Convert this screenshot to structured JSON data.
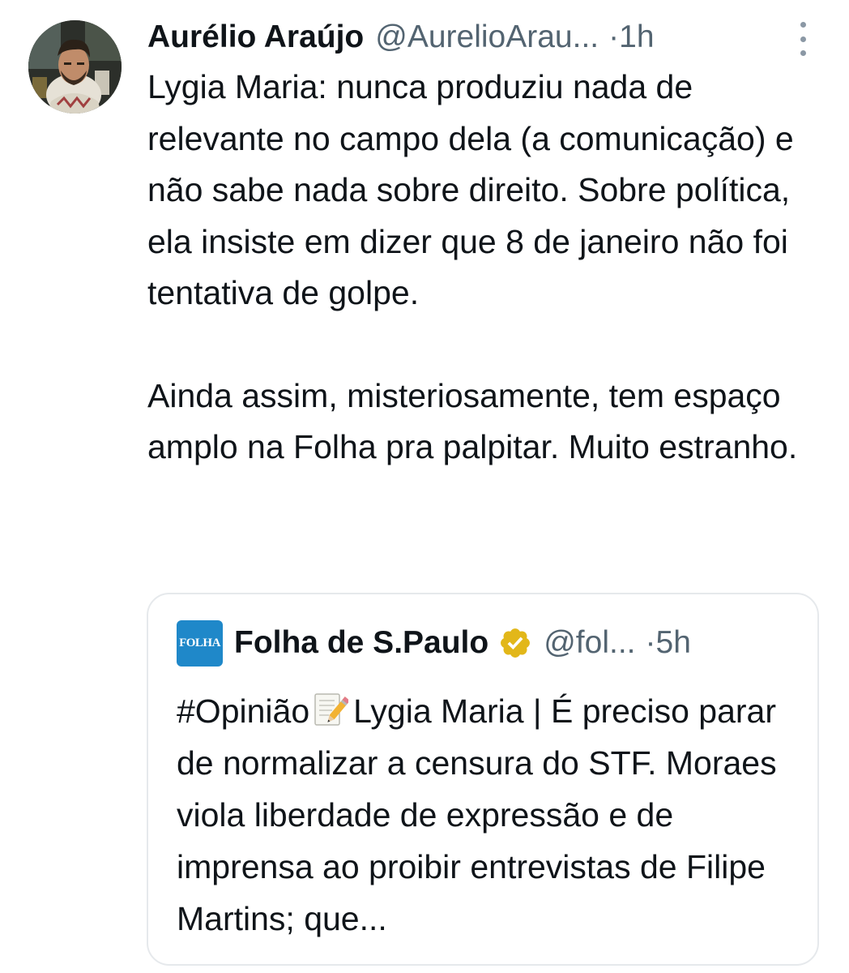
{
  "tweet": {
    "author": {
      "name": "Aurélio Araújo",
      "handle": "@AurelioArau...",
      "separator": "·",
      "time": "1h"
    },
    "paragraphs": [
      "Lygia Maria: nunca produziu nada de relevante no campo dela (a comunicação) e não sabe nada sobre direito. Sobre política, ela insiste em dizer que 8 de janeiro não foi tentativa de golpe.",
      "Ainda assim, misteriosamente, tem espaço amplo na Folha pra palpitar. Muito estranho."
    ],
    "more_icon": "more-vertical-icon",
    "avatar_icon": "avatar-photo"
  },
  "quoted": {
    "logo_text": "FOLHA",
    "name": "Folha de S.Paulo",
    "verified_icon": "verified-gold-badge-icon",
    "handle": "@fol...",
    "separator": "·",
    "time": "5h",
    "text_before_emoji": "#Opinião",
    "emoji_icon": "memo-pencil-icon",
    "text_after_emoji": "Lygia Maria | É preciso parar de normalizar a censura do STF. Moraes viola liberdade de expressão e de imprensa ao proibir entrevistas de Filipe Martins; que..."
  },
  "colors": {
    "text_primary": "#0f1419",
    "text_secondary": "#536471",
    "border": "#e6e9ec",
    "folha_blue": "#1f88c9",
    "verified_gold": "#e2b719"
  }
}
